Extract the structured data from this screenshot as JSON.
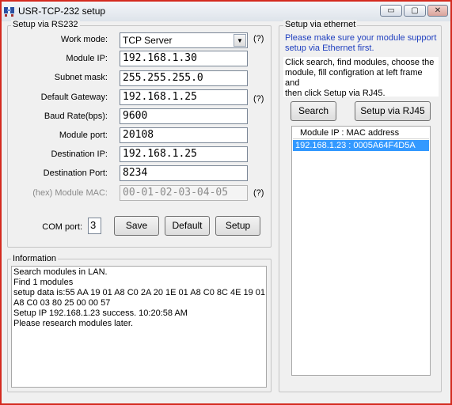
{
  "window": {
    "title": "USR-TCP-232 setup",
    "controls": {
      "minimize": "▭",
      "maximize": "▢",
      "close": "✕"
    }
  },
  "rs232": {
    "legend": "Setup via RS232",
    "work_mode": {
      "label": "Work mode:",
      "value": "TCP Server",
      "help": "(?)"
    },
    "module_ip": {
      "label": "Module IP:",
      "value": "192.168.1.30"
    },
    "subnet_mask": {
      "label": "Subnet mask:",
      "value": "255.255.255.0"
    },
    "default_gateway": {
      "label": "Default Gateway:",
      "value": "192.168.1.25",
      "help": "(?)"
    },
    "baud_rate": {
      "label": "Baud Rate(bps):",
      "value": "9600"
    },
    "module_port": {
      "label": "Module port:",
      "value": "20108"
    },
    "destination_ip": {
      "label": "Destination IP:",
      "value": "192.168.1.25"
    },
    "destination_port": {
      "label": "Destination Port:",
      "value": "8234"
    },
    "module_mac": {
      "label": "(hex) Module MAC:",
      "value": "00-01-02-03-04-05",
      "help": "(?)"
    },
    "com_port": {
      "label": "COM port:",
      "value": "3"
    },
    "buttons": {
      "save": "Save",
      "default": "Default",
      "setup": "Setup"
    }
  },
  "information": {
    "legend": "Information",
    "lines": [
      "Search modules in LAN.",
      "Find 1 modules",
      "setup data is:55 AA 19 01 A8 C0 2A 20 1E 01 A8 C0 8C 4E 19 01",
      "A8 C0 03 80 25 00 00 57",
      "Setup IP 192.168.1.23 success. 10:20:58 AM",
      "Please research modules later."
    ]
  },
  "ethernet": {
    "legend": "Setup via ethernet",
    "notice_lines": [
      "Please make sure your module support",
      "setup via Ethernet first."
    ],
    "instructions_lines": [
      "Click search, find modules, choose the",
      "module, fill configration at left frame and",
      "then click Setup via RJ45."
    ],
    "buttons": {
      "search": "Search",
      "setup_rj45": "Setup via RJ45"
    },
    "list": {
      "header": "Module IP : MAC address",
      "items": [
        "192.168.1.23 : 0005A64F4D5A"
      ]
    }
  },
  "colors": {
    "window_border": "#d42a1f",
    "notice_text": "#1f3fbf",
    "selection": "#3399ff"
  }
}
